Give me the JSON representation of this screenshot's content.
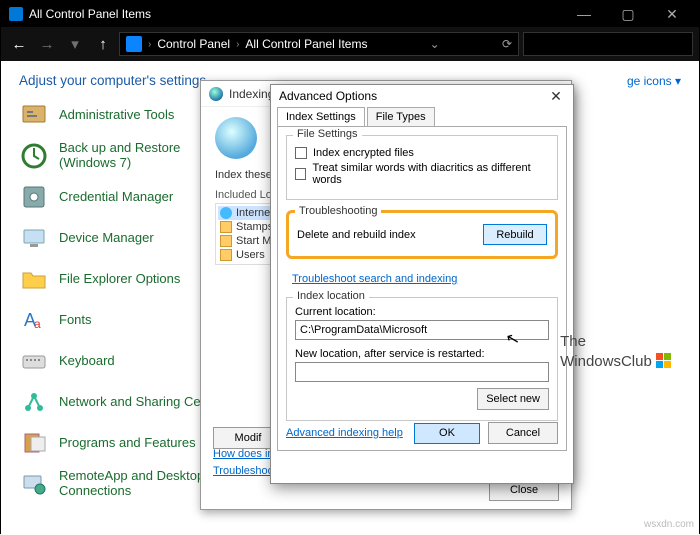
{
  "window": {
    "title": "All Control Panel Items",
    "breadcrumb": {
      "root": "Control Panel",
      "current": "All Control Panel Items"
    }
  },
  "body": {
    "header": "Adjust your computer's settings",
    "view_by": "ge icons ▾",
    "items": [
      {
        "label": "Administrative Tools"
      },
      {
        "label": "Back up and Restore (Windows 7)"
      },
      {
        "label": "Credential Manager"
      },
      {
        "label": "Device Manager"
      },
      {
        "label": "File Explorer Options"
      },
      {
        "label": "Fonts"
      },
      {
        "label": "Keyboard"
      },
      {
        "label": "Network and Sharing Centre"
      },
      {
        "label": "Programs and Features"
      },
      {
        "label": "RemoteApp and Desktop Connections"
      }
    ]
  },
  "indexing_dialog": {
    "title": "Indexing Options",
    "index_text": "Index these lo",
    "included_label": "Included Loc",
    "rows": [
      "Internet",
      "Stamps",
      "Start Me",
      "Users"
    ],
    "modify": "Modif",
    "link1": "How does inde",
    "link2": "Troubleshoot s",
    "close": "Close"
  },
  "adv_dialog": {
    "title": "Advanced Options",
    "tabs": {
      "settings": "Index Settings",
      "filetypes": "File Types"
    },
    "file_settings": {
      "legend": "File Settings",
      "opt1": "Index encrypted files",
      "opt2": "Treat similar words with diacritics as different words"
    },
    "troubleshooting": {
      "legend": "Troubleshooting",
      "text": "Delete and rebuild index",
      "rebuild": "Rebuild",
      "link": "Troubleshoot search and indexing"
    },
    "index_location": {
      "legend": "Index location",
      "current_label": "Current location:",
      "current_value": "C:\\ProgramData\\Microsoft",
      "new_label": "New location, after service is restarted:",
      "new_value": "",
      "select_new": "Select new"
    },
    "help_link": "Advanced indexing help",
    "ok": "OK",
    "cancel": "Cancel"
  },
  "watermark": {
    "site": "wsxdn.com",
    "brand1": "The",
    "brand2": "WindowsClub"
  }
}
